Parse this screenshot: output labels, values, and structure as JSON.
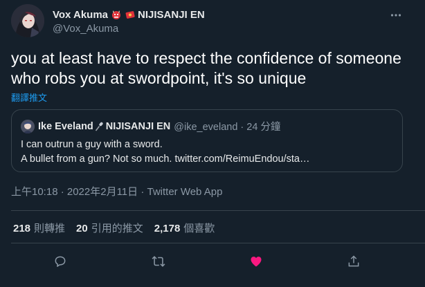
{
  "author": {
    "name": "Vox Akuma",
    "suffix": "NIJISANJI EN",
    "handle": "@Vox_Akuma",
    "name_emojis": [
      "oni-mask-icon",
      "red-envelope-icon"
    ]
  },
  "tweet": {
    "text": "you at least have to respect the confidence of someone who robs you at swordpoint, it's so unique",
    "translate_label": "翻譯推文"
  },
  "quote": {
    "name": "Ike Eveland",
    "suffix": "NIJISANJI EN",
    "handle_time": "@ike_eveland · 24 分鐘",
    "line1": "I can outrun a guy with a sword.",
    "line2": "A bullet from a gun? Not so much. twitter.com/ReimuEndou/sta…"
  },
  "meta": {
    "text": "上午10:18 · 2022年2月11日 · Twitter Web App"
  },
  "stats": {
    "retweets": "218",
    "retweets_label": "則轉推",
    "quotes": "20",
    "quotes_label": "引用的推文",
    "likes": "2,178",
    "likes_label": "個喜歡"
  },
  "colors": {
    "background": "#15202b",
    "accent": "#1d9bf0",
    "like": "#f91880",
    "secondary_text": "#8b98a5",
    "border": "#38444d"
  },
  "icons": {
    "more": "more-icon",
    "reply": "reply-icon",
    "retweet": "retweet-icon",
    "like": "heart-icon",
    "share": "share-icon"
  }
}
